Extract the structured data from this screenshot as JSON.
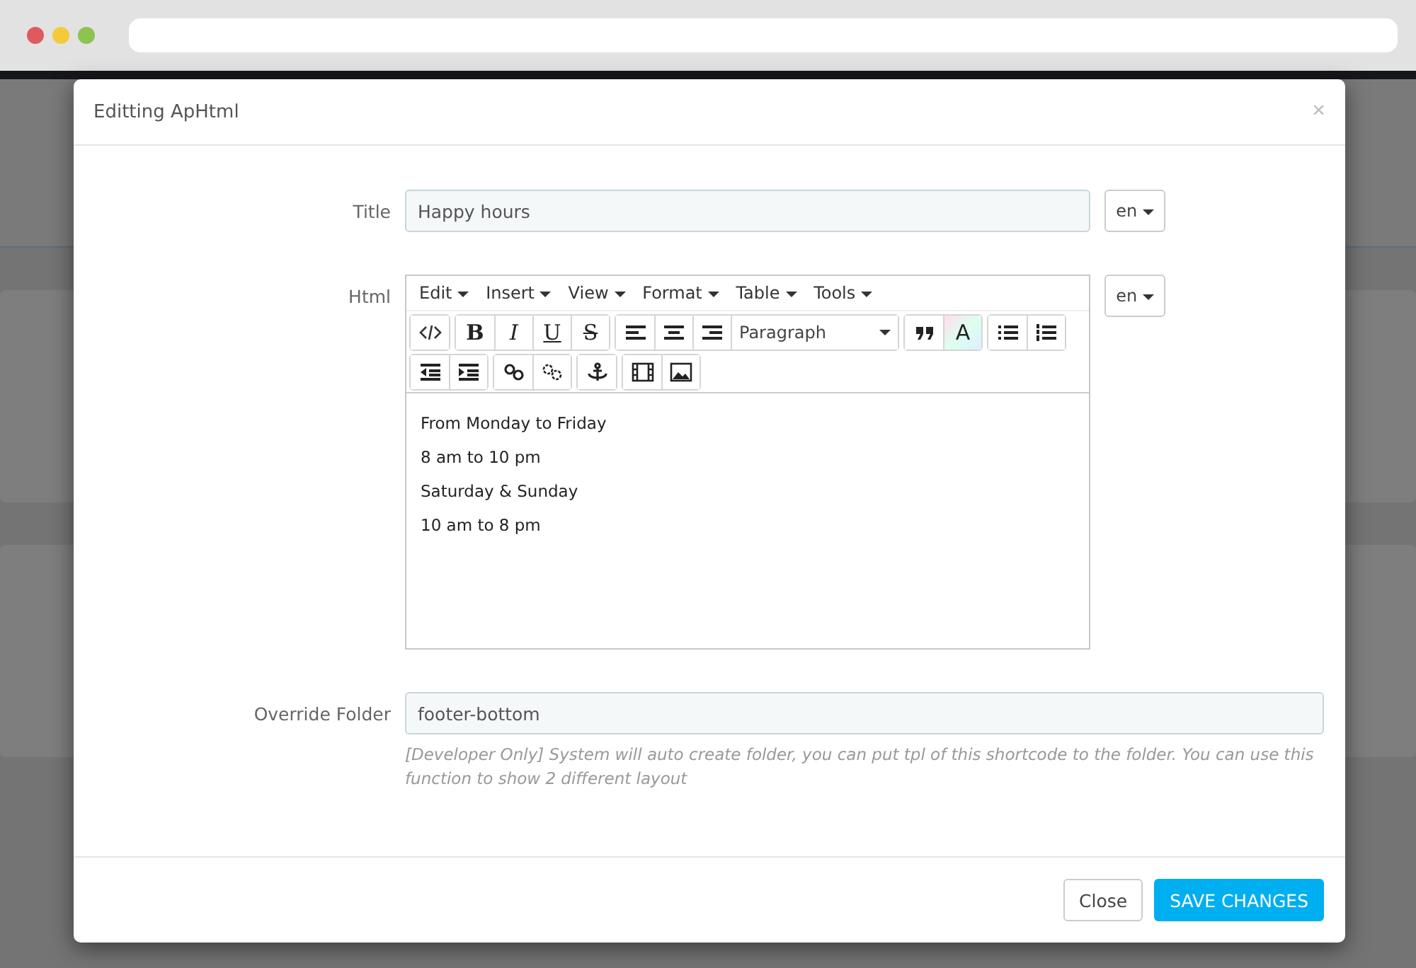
{
  "modal": {
    "title": "Editting ApHtml",
    "close": "×"
  },
  "fields": [
    {
      "kind": "text",
      "label": "Title",
      "value": "Happy hours",
      "lang": "en"
    },
    {
      "kind": "editor",
      "label": "Html",
      "lang": "en"
    },
    {
      "kind": "folder",
      "label": "Override Folder",
      "value": "footer-bottom",
      "help": "[Developer Only] System will auto create folder, you can put tpl of this shortcode to the folder. You can use this function to show 2 different layout"
    }
  ],
  "editor": {
    "menus": [
      "Edit",
      "Insert",
      "View",
      "Format",
      "Table",
      "Tools"
    ],
    "toolbar": [
      [
        [
          {
            "kind": "code"
          }
        ],
        [
          {
            "kind": "bold",
            "label": "B"
          },
          {
            "kind": "italic",
            "label": "I"
          },
          {
            "kind": "underline",
            "label": "U"
          },
          {
            "kind": "strike",
            "label": "S"
          }
        ],
        [
          {
            "kind": "align-left"
          },
          {
            "kind": "align-center"
          },
          {
            "kind": "align-right"
          },
          {
            "kind": "select",
            "label": "Paragraph"
          }
        ],
        [
          {
            "kind": "quote"
          },
          {
            "kind": "color",
            "label": "A"
          }
        ],
        [
          {
            "kind": "bullets"
          },
          {
            "kind": "numbers"
          }
        ]
      ],
      [
        [
          {
            "kind": "outdent"
          },
          {
            "kind": "indent"
          }
        ],
        [
          {
            "kind": "link"
          },
          {
            "kind": "unlink"
          }
        ],
        [
          {
            "kind": "anchor"
          }
        ],
        [
          {
            "kind": "video"
          },
          {
            "kind": "image"
          }
        ]
      ]
    ],
    "content": [
      "From Monday to Friday",
      "8 am to 10 pm",
      "Saturday & Sunday",
      "10 am to 8 pm"
    ]
  },
  "buttons": [
    {
      "label": "Close",
      "kind": "default"
    },
    {
      "label": "SAVE CHANGES",
      "kind": "primary"
    }
  ]
}
